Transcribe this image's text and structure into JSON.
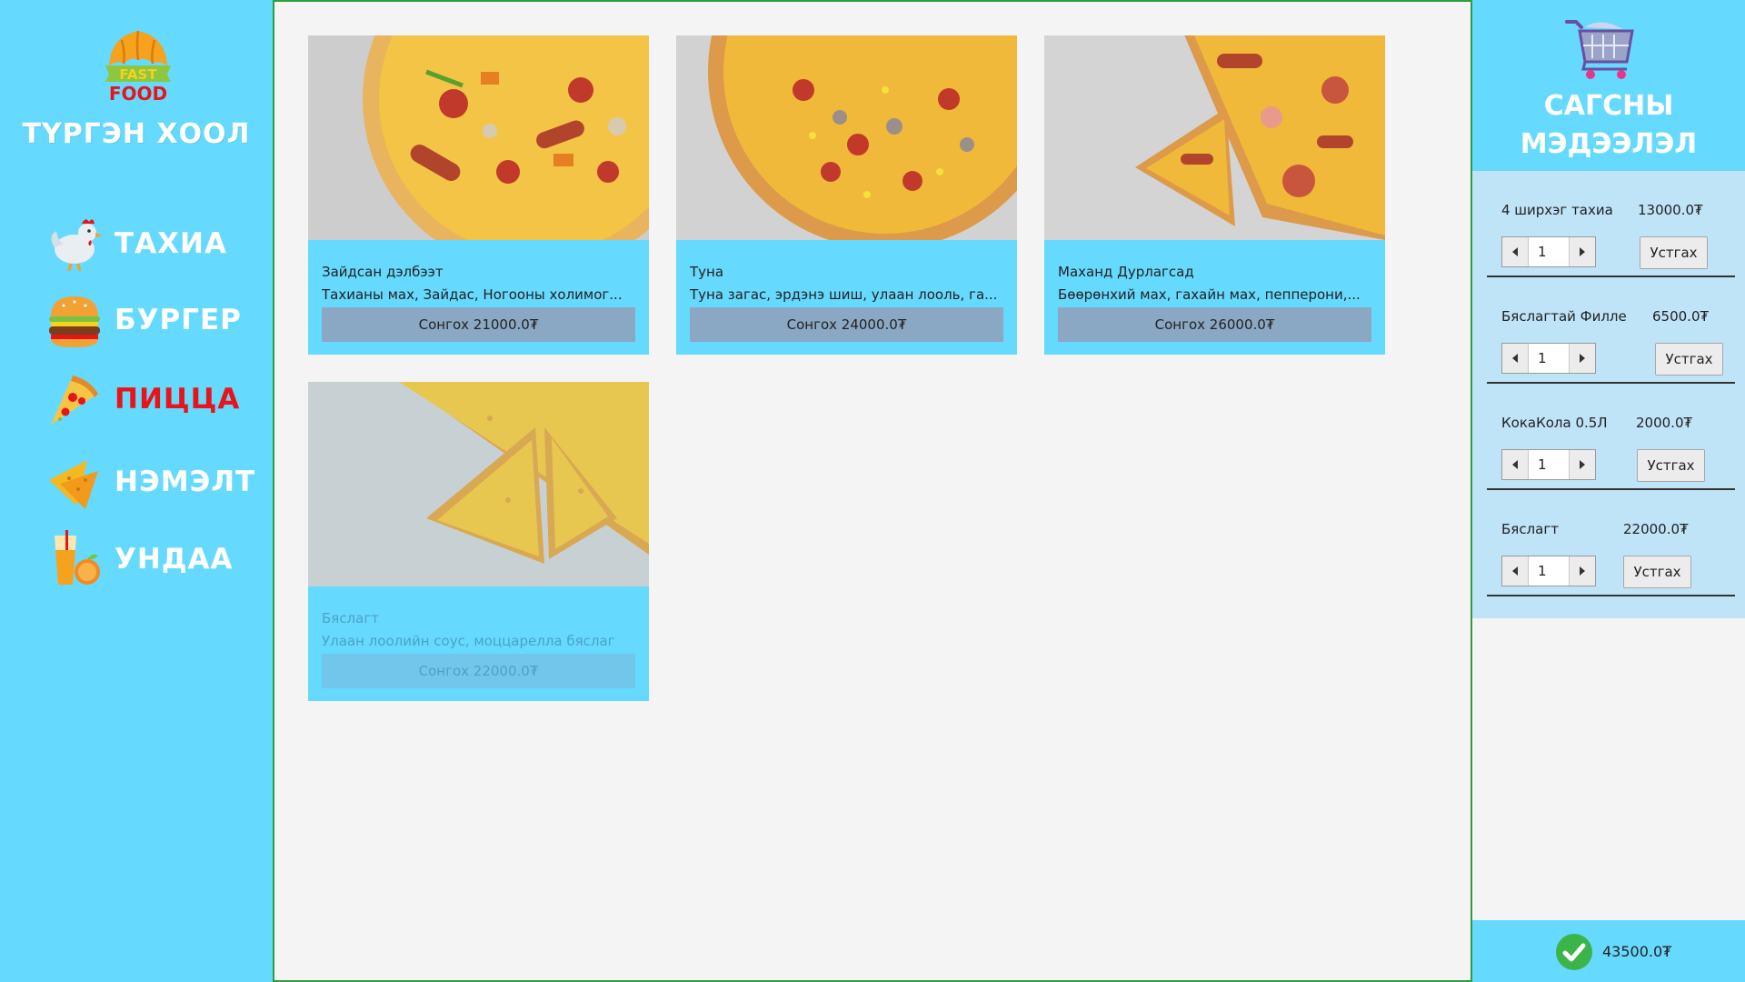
{
  "brand": {
    "logo_top": "FAST",
    "logo_bottom": "FOOD",
    "title": "ТҮРГЭН ХООЛ"
  },
  "nav": [
    {
      "label": "ТАХИА",
      "icon": "chicken-icon"
    },
    {
      "label": "БУРГЕР",
      "icon": "burger-icon"
    },
    {
      "label": "ПИЦЦА",
      "icon": "pizza-icon",
      "active": true
    },
    {
      "label": "НЭМЭЛТ",
      "icon": "nachos-icon"
    },
    {
      "label": "УНДАА",
      "icon": "juice-icon"
    }
  ],
  "products": [
    {
      "name": "Зайдсан дэлбээт",
      "desc": "Тахианы мах, Зайдас, Ногооны холимог...",
      "button": "Сонгох 21000.0₮"
    },
    {
      "name": "Туна",
      "desc": "Туна загас, эрдэнэ шиш, улаан лооль, га...",
      "button": "Сонгох 24000.0₮"
    },
    {
      "name": "Маханд Дурлагсад",
      "desc": "Бөөрөнхий мах, гахайн мах, пепперони,...",
      "button": "Сонгох 26000.0₮"
    },
    {
      "name": "Бяслагт",
      "desc": "Улаан лоолийн соус, моццарелла бяслаг",
      "button": "Сонгох 22000.0₮",
      "disabled": true
    }
  ],
  "cart": {
    "title_line1": "САГСНЫ",
    "title_line2": "МЭДЭЭЛЭЛ",
    "items": [
      {
        "name": "4 ширхэг тахиа",
        "price": "13000.0₮",
        "qty": "1",
        "remove": "Устгах"
      },
      {
        "name": "Бяслагтай Филле",
        "price": "6500.0₮",
        "qty": "1",
        "remove": "Устгах"
      },
      {
        "name": "КокаКола 0.5Л",
        "price": "2000.0₮",
        "qty": "1",
        "remove": "Устгах"
      },
      {
        "name": "Бяслагт",
        "price": "22000.0₮",
        "qty": "1",
        "remove": "Устгах"
      }
    ],
    "total": "43500.0₮"
  }
}
